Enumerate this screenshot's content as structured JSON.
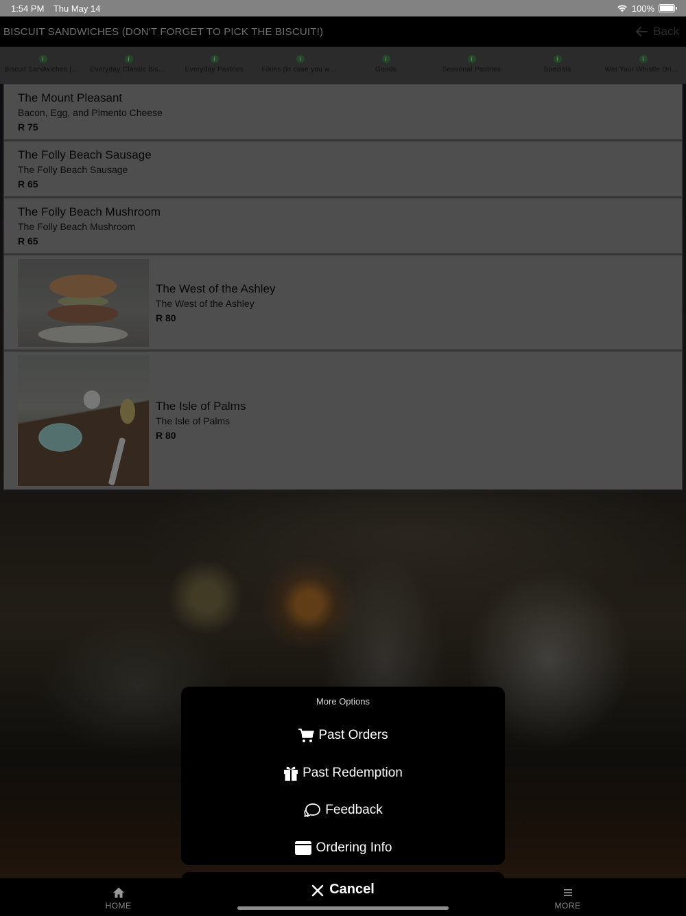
{
  "status_bar": {
    "time": "1:54 PM",
    "date": "Thu May 14",
    "battery": "100%"
  },
  "header": {
    "title": "BISCUIT SANDWICHES (DON'T FORGET TO PICK THE BISCUIT!)",
    "back_label": "Back"
  },
  "tabs": [
    {
      "label": "Biscuit Sandwiches (DON'T FORGET TO PICK THE BISCUIT!)",
      "icon": "info-icon"
    },
    {
      "label": "Everyday Classic Biscuits",
      "icon": "info-icon"
    },
    {
      "label": "Everyday Pastries",
      "icon": "info-icon"
    },
    {
      "label": "Fixins (in case you want more)",
      "icon": "info-icon"
    },
    {
      "label": "Goods",
      "icon": "info-icon"
    },
    {
      "label": "Seasonal Pastries",
      "icon": "info-icon"
    },
    {
      "label": "Specials",
      "icon": "info-icon"
    },
    {
      "label": "Wet Your Whistle Drinks",
      "icon": "info-icon"
    }
  ],
  "items": [
    {
      "name": "The Mount Pleasant",
      "desc": "Bacon, Egg, and Pimento Cheese",
      "price": "R 75"
    },
    {
      "name": "The Folly Beach Sausage",
      "desc": "The Folly Beach Sausage",
      "price": "R 65"
    },
    {
      "name": "The Folly Beach Mushroom",
      "desc": "The Folly Beach Mushroom",
      "price": "R 65"
    },
    {
      "name": "The West of the Ashley",
      "desc": "The West of the Ashley",
      "price": "R 80"
    },
    {
      "name": "The Isle of Palms",
      "desc": "The Isle of Palms",
      "price": "R 80"
    }
  ],
  "sheet": {
    "title": "More Options",
    "options": [
      {
        "label": "Past Orders",
        "icon": "cart-icon"
      },
      {
        "label": "Past Redemption",
        "icon": "gift-icon"
      },
      {
        "label": "Feedback",
        "icon": "chat-icon"
      },
      {
        "label": "Ordering Info",
        "icon": "card-icon"
      }
    ],
    "cancel_label": "Cancel"
  },
  "bottom_bar": {
    "home_label": "HOME",
    "more_label": "MORE"
  },
  "colors": {
    "accent_tab_icon": "#3f7a47",
    "header_bg": "#000000",
    "list_bg": "#878787"
  }
}
